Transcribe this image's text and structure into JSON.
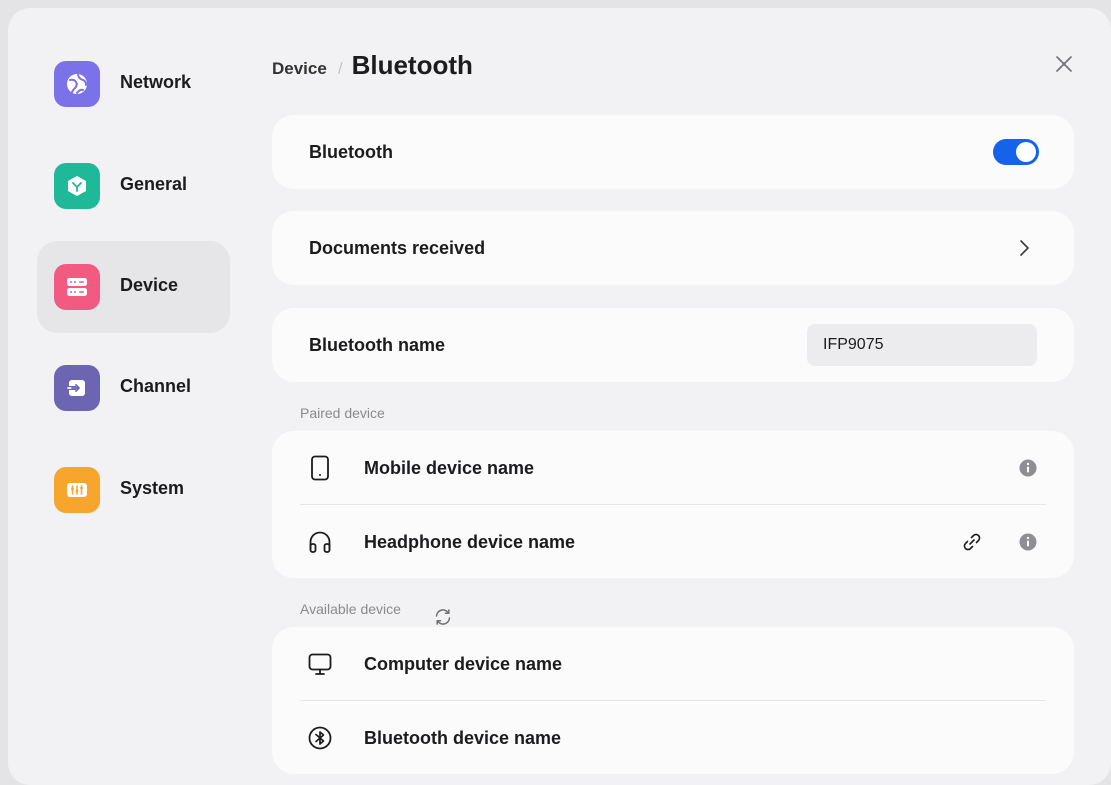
{
  "sidebar": {
    "items": [
      {
        "label": "Network",
        "icon": "globe-icon",
        "color": "#7b72ea"
      },
      {
        "label": "General",
        "icon": "cube-icon",
        "color": "#1fb99a"
      },
      {
        "label": "Device",
        "icon": "server-icon",
        "color": "#f25a82",
        "active": true
      },
      {
        "label": "Channel",
        "icon": "input-icon",
        "color": "#6d64b2"
      },
      {
        "label": "System",
        "icon": "sliders-icon",
        "color": "#f8a52d"
      }
    ]
  },
  "header": {
    "breadcrumb_parent": "Device",
    "separator": "/",
    "title": "Bluetooth"
  },
  "settings": {
    "bluetooth_label": "Bluetooth",
    "bluetooth_enabled": true,
    "documents_label": "Documents received",
    "name_label": "Bluetooth name",
    "name_value": "IFP9075"
  },
  "paired": {
    "section_label": "Paired device",
    "devices": [
      {
        "name": "Mobile device name",
        "icon": "phone-icon"
      },
      {
        "name": "Headphone device name",
        "icon": "headphone-icon",
        "connected_link": true
      }
    ]
  },
  "available": {
    "section_label": "Available device",
    "devices": [
      {
        "name": "Computer device name",
        "icon": "monitor-icon"
      },
      {
        "name": "Bluetooth device name",
        "icon": "bluetooth-icon"
      }
    ]
  },
  "colors": {
    "accent": "#1463ea",
    "background": "#f2f2f4",
    "card": "#fbfbfc"
  }
}
